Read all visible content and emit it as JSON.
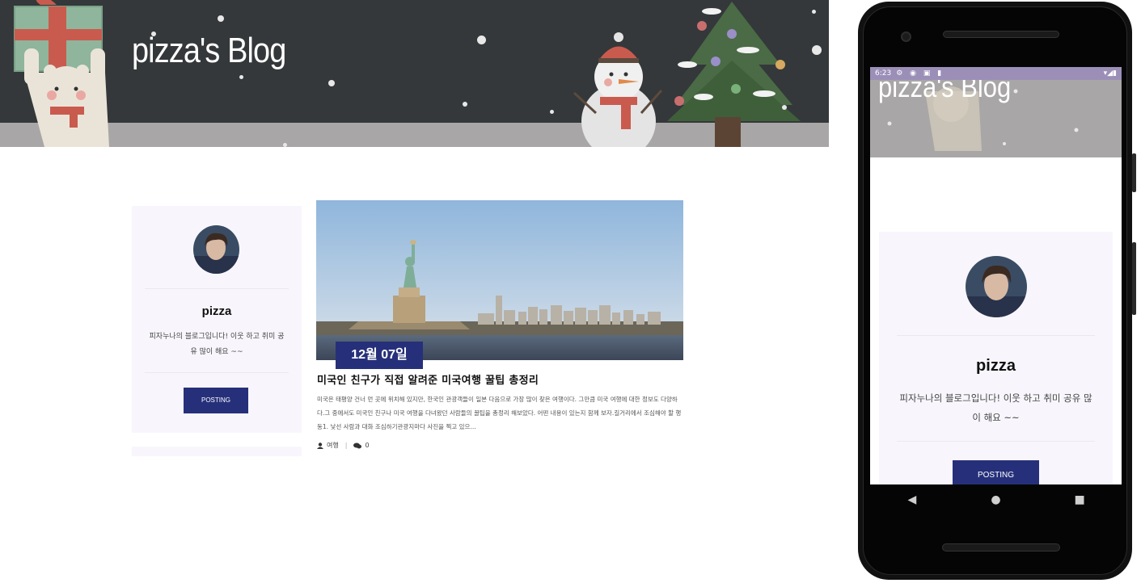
{
  "desktop": {
    "blog_title": "pizza's Blog",
    "profile": {
      "name": "pizza",
      "description": "피자누나의 블로그입니다! 이웃 하고 취미 공유 많이 해요 ~~",
      "button_label": "POSTING"
    },
    "post": {
      "date_badge": "12월 07일",
      "title": "미국인 친구가 직접 알려준 미국여행 꿀팁 총정리",
      "excerpt": "미국은 태평양 건너 먼 곳에 위치해 있지만, 한국인 관광객들이 일본 다음으로 가장 많이 찾은 여행이다. 그만큼 미국 여행에 대한 정보도 다양하다.그 중에서도 미국인 친구나 미국 여행을 다녀왔던 사람들의 꿀팁을 총정리 해보았다. 어떤 내용이 있는지 함께 보자.길거리에서 조심해야 할 행동1. 낯선 사람과 대화 조심하기관광지마다 사진을 찍고 있으...",
      "category": "여행",
      "comment_count": "0"
    }
  },
  "mobile": {
    "status_time": "6:23",
    "blog_title": "pizza's Blog",
    "profile": {
      "name": "pizza",
      "description": "피자누나의 블로그입니다! 이웃 하고 취미 공유 많이 해요 ~~",
      "button_label": "POSTING"
    }
  },
  "colors": {
    "banner_dark": "#34383a",
    "banner_ground": "#a8a6a6",
    "accent_navy": "#26307a",
    "card_bg": "#f8f6fc",
    "status_bar": "#9b8fb8"
  }
}
